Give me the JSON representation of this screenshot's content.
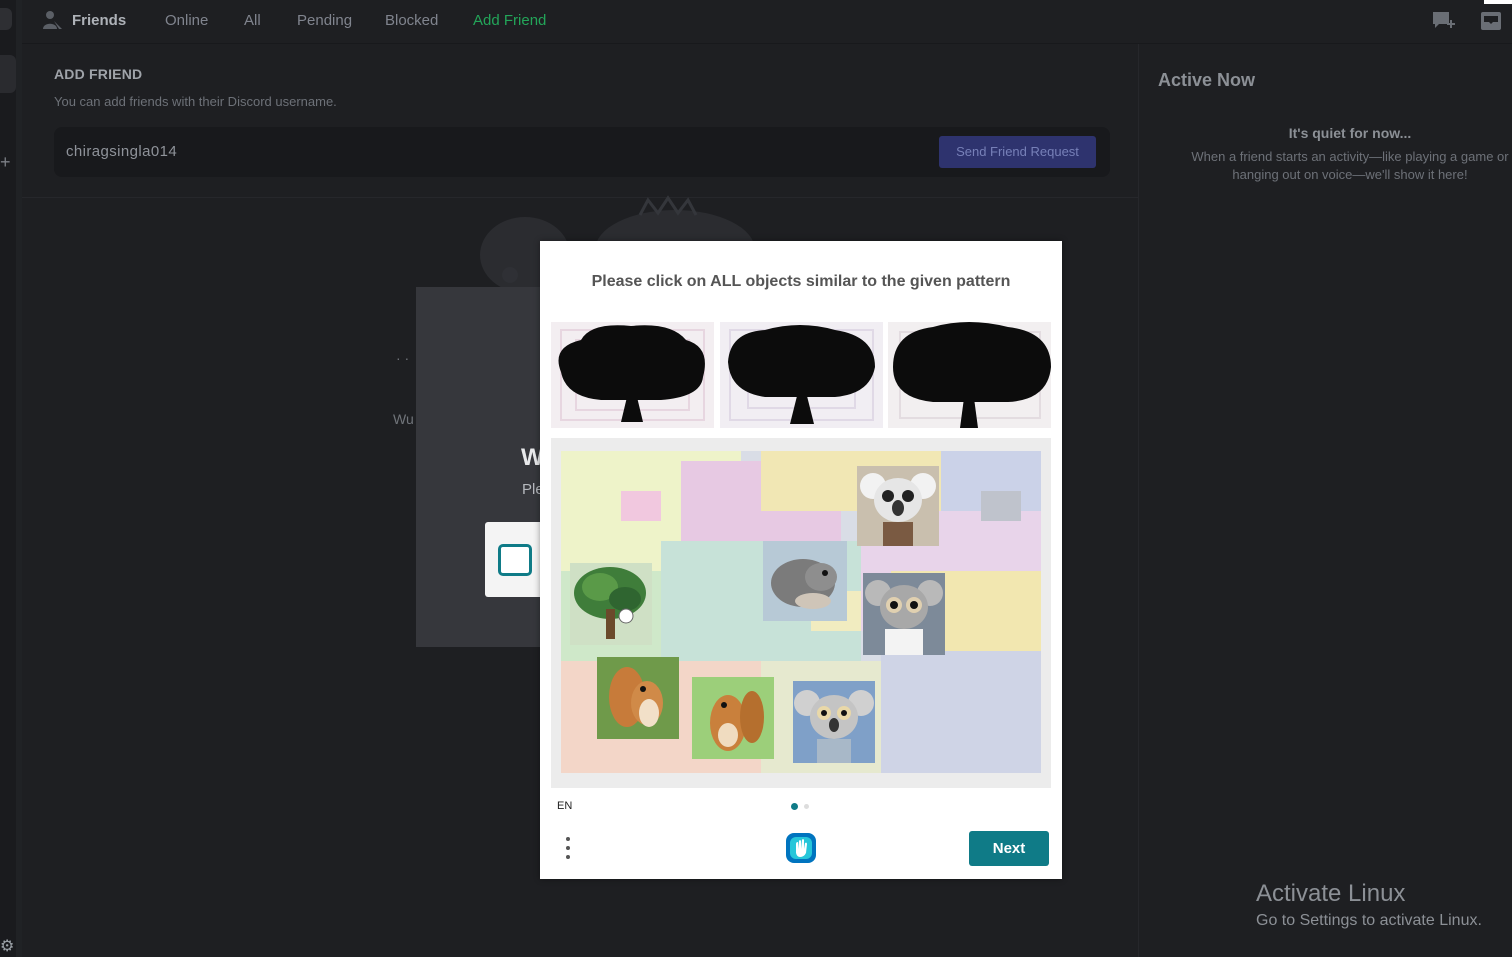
{
  "topbar": {
    "title": "Friends",
    "tabs": [
      "Online",
      "All",
      "Pending",
      "Blocked",
      "Add Friend"
    ]
  },
  "add_friend": {
    "heading": "ADD FRIEND",
    "subtitle": "You can add friends with their Discord username.",
    "input_value": "chiragsingla014",
    "button_label": "Send Friend Request"
  },
  "active_now": {
    "title": "Active Now",
    "quiet": "It's quiet for now...",
    "description": "When a friend starts an activity—like playing a game or hanging out on voice—we'll show it here!"
  },
  "underlay": {
    "dots": "· ·",
    "wu": "Wu",
    "heading": "W",
    "text": "Ple"
  },
  "captcha": {
    "prompt": "Please click on ALL objects similar to the given pattern",
    "language": "EN",
    "next_label": "Next",
    "accent": "#0f7b87"
  },
  "watermark": {
    "line1": "Activate Linux",
    "line2": "Go to Settings to activate Linux."
  }
}
